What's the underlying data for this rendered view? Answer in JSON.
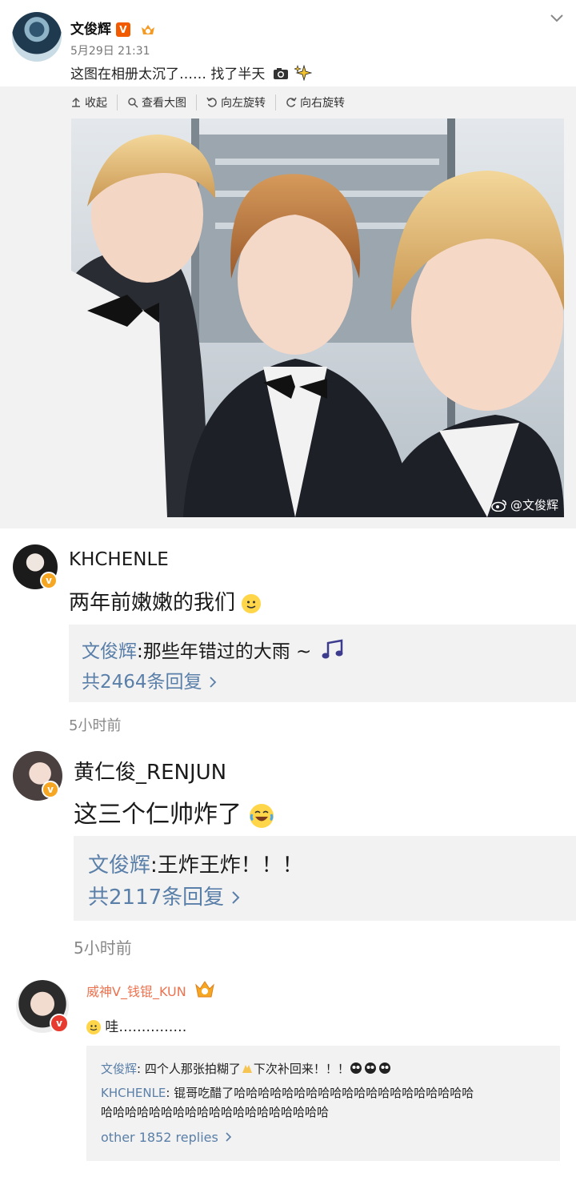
{
  "post": {
    "username": "文俊辉",
    "verified_badge": "V",
    "timestamp": "5月29日 21:31",
    "text": "这图在相册太沉了…… 找了半天",
    "toolbar": {
      "collapse": "收起",
      "view_large": "查看大图",
      "rotate_left": "向左旋转",
      "rotate_right": "向右旋转"
    },
    "watermark": "@文俊辉",
    "icons": [
      "chevron-down-icon",
      "camera-icon",
      "sparkle-icon",
      "weibo-logo-icon"
    ]
  },
  "comments": [
    {
      "username": "KHCHENLE",
      "text": "两年前嫩嫩的我们",
      "reply_author": "文俊辉",
      "reply_text": ":那些年错过的大雨 ~",
      "reply_count": "共2464条回复",
      "time": "5小时前"
    },
    {
      "username": "黄仁俊_RENJUN",
      "text": "这三个仁帅炸了",
      "reply_author": "文俊辉",
      "reply_text": ":王炸王炸！！！",
      "reply_count": "共2117条回复",
      "time": "5小时前"
    },
    {
      "username": "威神V_钱锟_KUN",
      "text": "哇……………",
      "replies": [
        {
          "author": "文俊辉",
          "text": ": 四个人那张拍糊了",
          "text2": "下次补回来！！！"
        },
        {
          "author": "KHCHENLE",
          "text": ": 锟哥吃醋了哈哈哈哈哈哈哈哈哈哈哈哈哈哈哈哈哈哈哈哈",
          "text_line2": "哈哈哈哈哈哈哈哈哈哈哈哈哈哈哈哈哈哈哈"
        }
      ],
      "more_replies": "other 1852 replies"
    }
  ],
  "colors": {
    "link_blue": "#5a7fa8",
    "orange_name": "#eb7350",
    "reply_bg": "#f2f2f2",
    "verified_gold": "#f5a623",
    "verified_red": "#e63b2e"
  }
}
